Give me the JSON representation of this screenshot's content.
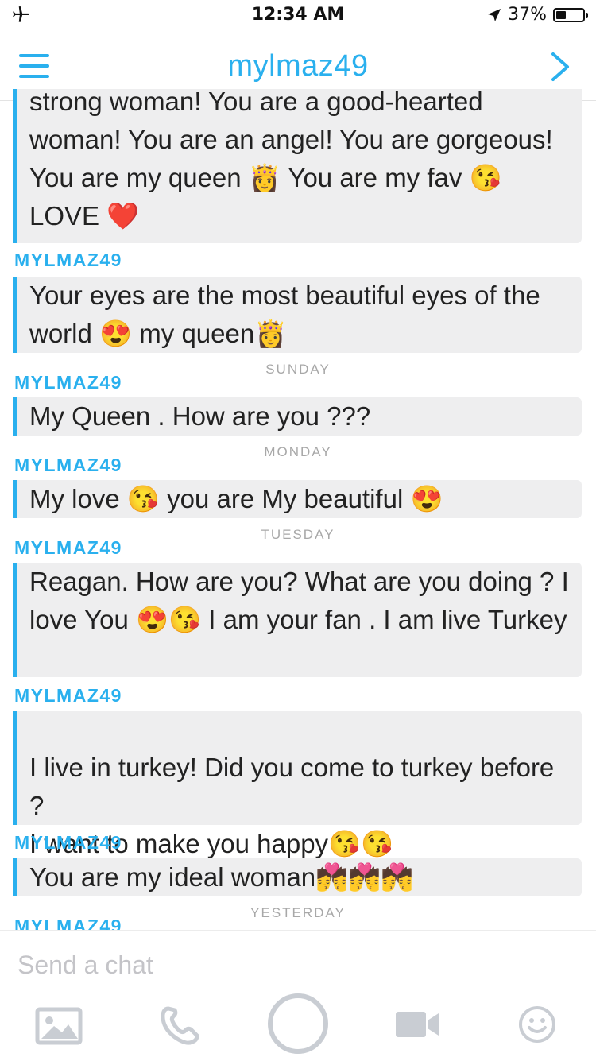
{
  "status": {
    "time": "12:34 AM",
    "battery": "37%",
    "battery_level": 0.37
  },
  "header": {
    "title": "mylmaz49"
  },
  "messages": [
    {
      "sender": "",
      "text": "strong woman! You are a good-hearted woman! You are an angel!  You are gorgeous! You are my queen 👸 You are my fav 😘 LOVE ❤️"
    },
    {
      "sender": "MYLMAZ49",
      "text": "Your eyes are the most beautiful eyes of the world 😍 my queen👸"
    },
    {
      "day": "SUNDAY",
      "sender": "MYLMAZ49",
      "text": "My Queen . How are you  ???"
    },
    {
      "day": "MONDAY",
      "sender": "MYLMAZ49",
      "text": "My love 😘 you are My beautiful 😍"
    },
    {
      "day": "TUESDAY",
      "sender": "MYLMAZ49",
      "text": "Reagan. How are you? What are you doing ? I love You 😍😘 I am your fan  . I am live Turkey"
    },
    {
      "sender": "MYLMAZ49",
      "text": "I live in turkey! Did you come to turkey before ?\nI want to make you happy😘😘"
    },
    {
      "sender": "MYLMAZ49",
      "text": "You are my ideal woman💏💏💏"
    },
    {
      "day": "YESTERDAY",
      "sender": "MYLMAZ49"
    }
  ],
  "composer": {
    "placeholder": "Send a chat"
  },
  "toolbar": {
    "icons": [
      "image-icon",
      "phone-icon",
      "capture-circle-icon",
      "video-icon",
      "smiley-icon"
    ]
  },
  "colors": {
    "accent": "#2ab0ee",
    "bubble": "#eeeeef",
    "muted": "#a8a8a8"
  }
}
